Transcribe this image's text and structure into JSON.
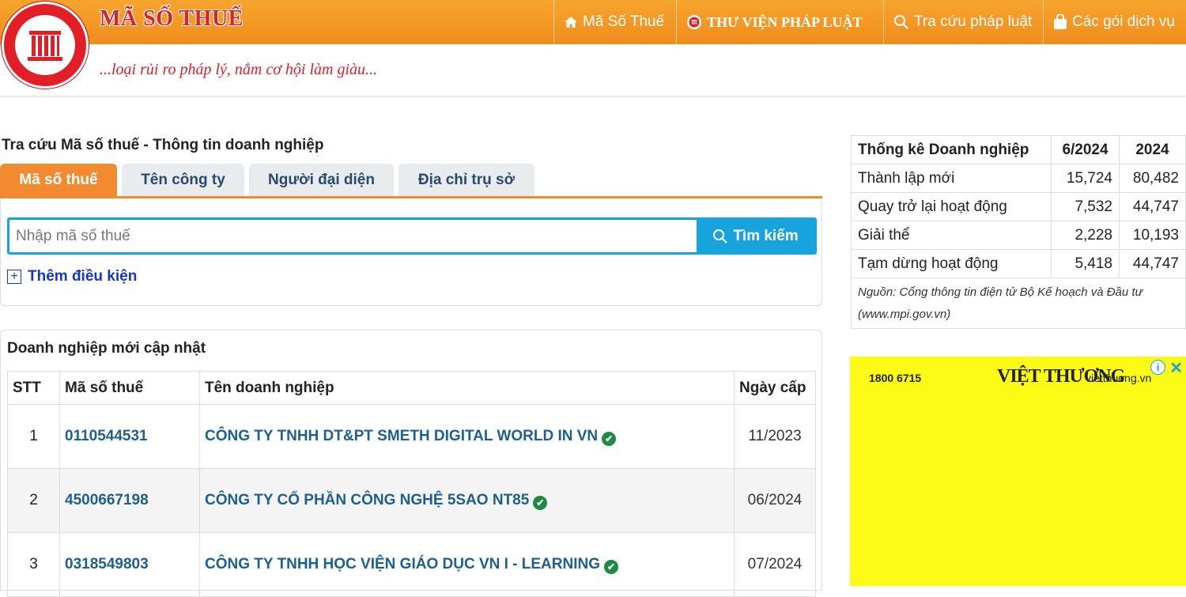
{
  "header": {
    "title": "MÃ SỐ THUẾ",
    "slogan": "...loại rủi ro pháp lý, nắm cơ hội làm giàu...",
    "nav": [
      {
        "label": "Mã Số Thuế",
        "icon": "home-icon"
      },
      {
        "label": "THƯ VIỆN PHÁP LUẬT",
        "icon": "library-logo-icon"
      },
      {
        "label": "Tra cứu pháp luật",
        "icon": "search-icon"
      },
      {
        "label": "Các gói dịch vụ",
        "icon": "bag-icon"
      }
    ],
    "colors": {
      "bar": "#f08c1c",
      "brand_red": "#e21f26"
    }
  },
  "search": {
    "section_title": "Tra cứu Mã số thuế - Thông tin doanh nghiệp",
    "tabs": [
      "Mã số thuế",
      "Tên công ty",
      "Người đại diện",
      "Địa chỉ trụ sở"
    ],
    "active_tab": "Mã số thuế",
    "placeholder": "Nhập mã số thuế",
    "button_label": "Tìm kiếm",
    "add_condition": "Thêm điều kiện",
    "colors": {
      "accent": "#f28a30",
      "button": "#17a3dc"
    }
  },
  "companies": {
    "title": "Doanh nghiệp mới cập nhật",
    "headers": [
      "STT",
      "Mã số thuế",
      "Tên doanh nghiệp",
      "Ngày cấp"
    ],
    "rows": [
      {
        "stt": "1",
        "mst": "0110544531",
        "name": "CÔNG TY TNHH DT&PT SMETH DIGITAL WORLD IN VN",
        "date": "11/2023"
      },
      {
        "stt": "2",
        "mst": "4500667198",
        "name": "CÔNG TY CỔ PHẦN CÔNG NGHỆ 5SAO NT85",
        "date": "06/2024"
      },
      {
        "stt": "3",
        "mst": "0318549803",
        "name": "CÔNG TY TNHH HỌC VIỆN GIÁO DỤC VN I - LEARNING",
        "date": "07/2024"
      }
    ]
  },
  "stats": {
    "headers": [
      "Thống kê Doanh nghiệp",
      "6/2024",
      "2024"
    ],
    "rows": [
      {
        "label": "Thành lập mới",
        "month": "15,724",
        "year": "80,482"
      },
      {
        "label": "Quay trở lại hoạt động",
        "month": "7,532",
        "year": "44,747"
      },
      {
        "label": "Giải thể",
        "month": "2,228",
        "year": "10,193"
      },
      {
        "label": "Tạm dừng hoạt động",
        "month": "5,418",
        "year": "44,747"
      }
    ],
    "source": "Nguồn: Cổng thông tin điện tử Bộ Kế hoạch và Đầu tư (www.mpi.gov.vn)"
  },
  "ad": {
    "phone": "1800 6715",
    "brand": "VIỆT THƯƠNG",
    "site": "vietthuong.vn",
    "info": "i",
    "close": "✕",
    "background": "#fbfb15"
  }
}
